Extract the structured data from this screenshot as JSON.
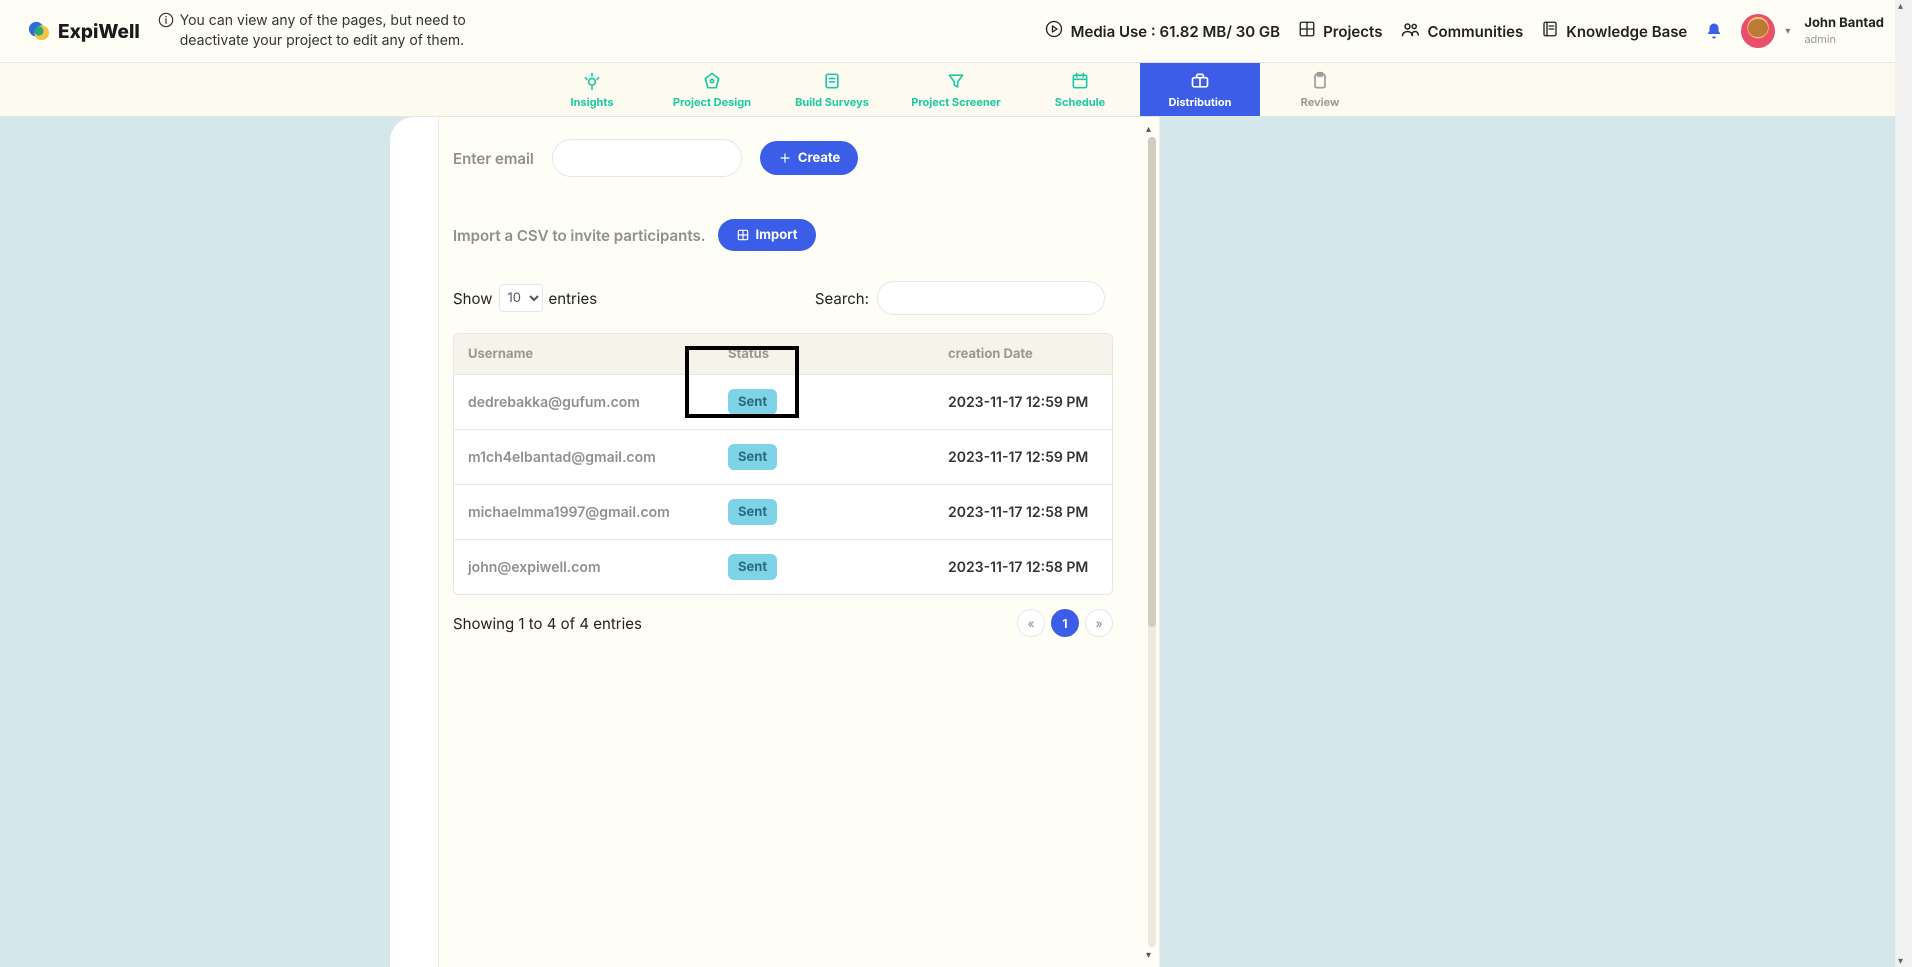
{
  "brand": {
    "name": "ExpiWell"
  },
  "info_banner": "You can view any of the pages, but need to deactivate your project to edit any of them.",
  "header": {
    "media_use_label": "Media Use : 61.82 MB/ 30 GB",
    "links": {
      "projects": "Projects",
      "communities": "Communities",
      "knowledge_base": "Knowledge Base"
    },
    "user": {
      "name": "John Bantad",
      "role": "admin"
    }
  },
  "tabs": {
    "insights": "Insights",
    "project_design": "Project Design",
    "build_surveys": "Build Surveys",
    "project_screener": "Project Screener",
    "schedule": "Schedule",
    "distribution": "Distribution",
    "review": "Review"
  },
  "panel": {
    "enter_email_label": "Enter email",
    "create_label": "Create",
    "csv_label": "Import a CSV to invite participants.",
    "import_label": "Import",
    "show_label": "Show",
    "entries_label": "entries",
    "show_value": "10",
    "search_label": "Search:",
    "search_value": ""
  },
  "table": {
    "columns": {
      "username": "Username",
      "status": "Status",
      "date": "creation Date"
    },
    "rows": [
      {
        "username": "dedrebakka@gufum.com",
        "status": "Sent",
        "date": "2023-11-17 12:59 PM"
      },
      {
        "username": "m1ch4elbantad@gmail.com",
        "status": "Sent",
        "date": "2023-11-17 12:59 PM"
      },
      {
        "username": "michaelmma1997@gmail.com",
        "status": "Sent",
        "date": "2023-11-17 12:58 PM"
      },
      {
        "username": "john@expiwell.com",
        "status": "Sent",
        "date": "2023-11-17 12:58 PM"
      }
    ],
    "footer": "Showing 1 to 4 of 4 entries",
    "page": "1"
  }
}
